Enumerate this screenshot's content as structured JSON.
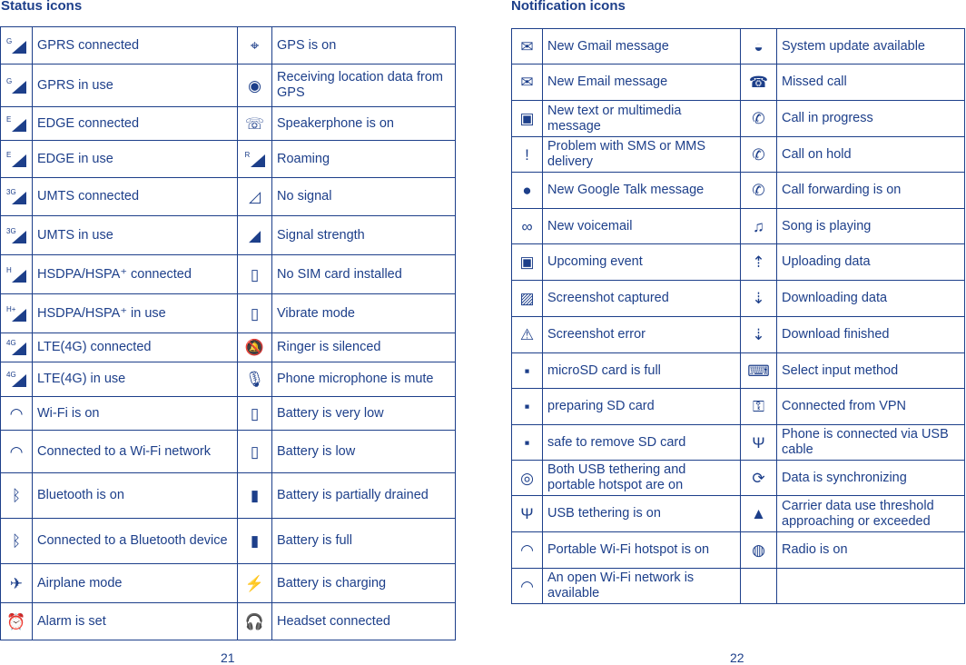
{
  "left": {
    "title": "Status icons",
    "page": "21",
    "rows": [
      [
        {
          "icon": "signal-g-icon",
          "tag": "G",
          "label": "GPRS connected"
        },
        {
          "icon": "gps-on-icon",
          "label": "GPS is on"
        }
      ],
      [
        {
          "icon": "signal-g-icon",
          "tag": "G",
          "label": "GPRS in use"
        },
        {
          "icon": "gps-receiving-icon",
          "label": "Receiving location data from GPS"
        }
      ],
      [
        {
          "icon": "signal-e-icon",
          "tag": "E",
          "label": "EDGE connected"
        },
        {
          "icon": "speakerphone-icon",
          "label": "Speakerphone is on"
        }
      ],
      [
        {
          "icon": "signal-e-icon",
          "tag": "E",
          "label": "EDGE in use"
        },
        {
          "icon": "roaming-icon",
          "tag": "R",
          "label": "Roaming"
        }
      ],
      [
        {
          "icon": "signal-3g-icon",
          "tag": "3G",
          "label": "UMTS connected"
        },
        {
          "icon": "no-signal-icon",
          "label": "No signal"
        }
      ],
      [
        {
          "icon": "signal-3g-icon",
          "tag": "3G",
          "label": "UMTS in use"
        },
        {
          "icon": "signal-strength-icon",
          "label": "Signal strength"
        }
      ],
      [
        {
          "icon": "signal-h-icon",
          "tag": "H",
          "label": "HSDPA/HSPA⁺ connected"
        },
        {
          "icon": "no-sim-icon",
          "label": "No SIM card installed"
        }
      ],
      [
        {
          "icon": "signal-hplus-icon",
          "tag": "H+",
          "label": "HSDPA/HSPA⁺ in use"
        },
        {
          "icon": "vibrate-icon",
          "label": "Vibrate mode"
        }
      ],
      [
        {
          "icon": "signal-4g-icon",
          "tag": "4G",
          "label": "LTE(4G) connected"
        },
        {
          "icon": "ringer-silenced-icon",
          "label": "Ringer is silenced"
        }
      ],
      [
        {
          "icon": "signal-4g-icon",
          "tag": "4G",
          "label": "LTE(4G) in use"
        },
        {
          "icon": "mic-mute-icon",
          "label": "Phone microphone is mute"
        }
      ],
      [
        {
          "icon": "wifi-icon",
          "label": "Wi-Fi is on"
        },
        {
          "icon": "battery-very-low-icon",
          "label": "Battery is very low"
        }
      ],
      [
        {
          "icon": "wifi-connected-icon",
          "label": "Connected to a Wi-Fi network"
        },
        {
          "icon": "battery-low-icon",
          "label": "Battery is low"
        }
      ],
      [
        {
          "icon": "bluetooth-icon",
          "label": "Bluetooth is on"
        },
        {
          "icon": "battery-partial-icon",
          "label": "Battery is partially drained"
        }
      ],
      [
        {
          "icon": "bluetooth-connected-icon",
          "label": "Connected to a Bluetooth device"
        },
        {
          "icon": "battery-full-icon",
          "label": "Battery is full"
        }
      ],
      [
        {
          "icon": "airplane-icon",
          "label": "Airplane mode"
        },
        {
          "icon": "battery-charging-icon",
          "label": "Battery is charging"
        }
      ],
      [
        {
          "icon": "alarm-icon",
          "label": "Alarm is set"
        },
        {
          "icon": "headset-icon",
          "label": "Headset connected"
        }
      ]
    ]
  },
  "right": {
    "title": "Notification icons",
    "page": "22",
    "rows": [
      [
        {
          "icon": "gmail-icon",
          "label": "New Gmail message"
        },
        {
          "icon": "system-update-icon",
          "label": "System update available"
        }
      ],
      [
        {
          "icon": "email-icon",
          "label": "New Email message"
        },
        {
          "icon": "missed-call-icon",
          "label": "Missed call"
        }
      ],
      [
        {
          "icon": "sms-icon",
          "label": "New text or multimedia message"
        },
        {
          "icon": "call-icon",
          "label": "Call in progress"
        }
      ],
      [
        {
          "icon": "sms-problem-icon",
          "label": "Problem with SMS or MMS delivery"
        },
        {
          "icon": "call-hold-icon",
          "label": "Call on hold"
        }
      ],
      [
        {
          "icon": "talk-icon",
          "label": "New Google Talk message"
        },
        {
          "icon": "call-forward-icon",
          "label": "Call forwarding is on"
        }
      ],
      [
        {
          "icon": "voicemail-icon",
          "label": "New voicemail"
        },
        {
          "icon": "music-icon",
          "label": "Song is playing"
        }
      ],
      [
        {
          "icon": "calendar-icon",
          "label": "Upcoming event"
        },
        {
          "icon": "upload-icon",
          "label": "Uploading data"
        }
      ],
      [
        {
          "icon": "screenshot-icon",
          "label": "Screenshot captured"
        },
        {
          "icon": "download-icon",
          "label": "Downloading data"
        }
      ],
      [
        {
          "icon": "screenshot-error-icon",
          "label": "Screenshot error"
        },
        {
          "icon": "download-done-icon",
          "label": "Download finished"
        }
      ],
      [
        {
          "icon": "sd-full-icon",
          "label": "microSD card is full"
        },
        {
          "icon": "keyboard-icon",
          "label": "Select input method"
        }
      ],
      [
        {
          "icon": "sd-preparing-icon",
          "label": "preparing SD card"
        },
        {
          "icon": "vpn-key-icon",
          "label": " Connected from VPN"
        }
      ],
      [
        {
          "icon": "sd-remove-icon",
          "label": "safe to remove SD card"
        },
        {
          "icon": "usb-icon",
          "label": "Phone is connected via USB cable"
        }
      ],
      [
        {
          "icon": "tethering-both-icon",
          "label": "Both USB tethering and portable hotspot are on"
        },
        {
          "icon": "sync-icon",
          "label": "Data is synchronizing"
        }
      ],
      [
        {
          "icon": "usb-tether-icon",
          "label": "USB tethering is on"
        },
        {
          "icon": "warning-icon",
          "label": "Carrier data use threshold approaching or exceeded"
        }
      ],
      [
        {
          "icon": "hotspot-icon",
          "label": "Portable Wi-Fi hotspot is on"
        },
        {
          "icon": "radio-icon",
          "label": "Radio is on"
        }
      ],
      [
        {
          "icon": "open-wifi-icon",
          "label": "An open Wi-Fi network is available"
        },
        {
          "icon": "",
          "label": ""
        }
      ]
    ]
  }
}
